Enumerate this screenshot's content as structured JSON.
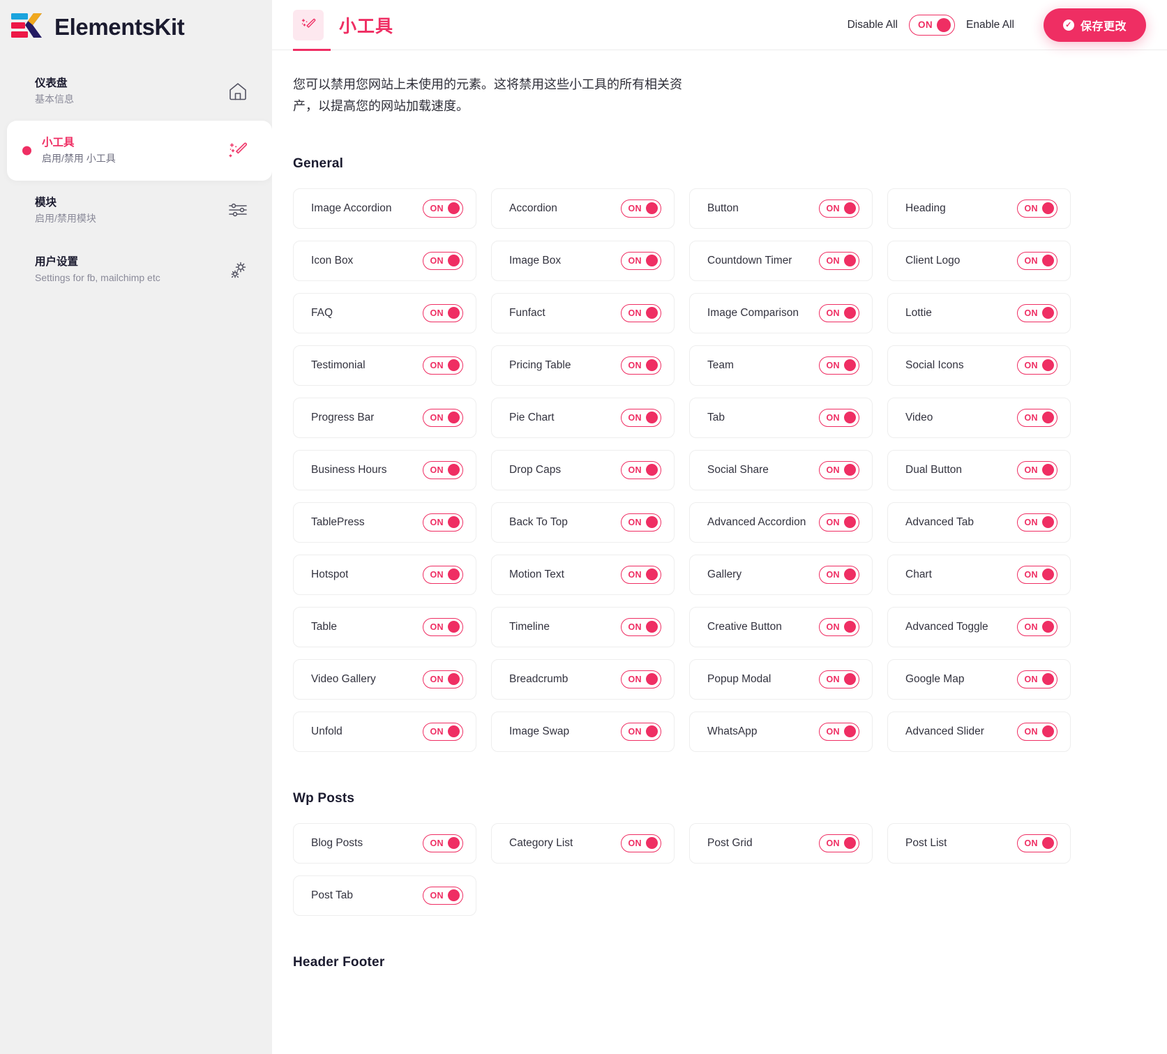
{
  "brand": {
    "name": "ElementsKit",
    "logo_icon": "elementskit-logo"
  },
  "sidebar": {
    "items": [
      {
        "title": "仪表盘",
        "subtitle": "基本信息",
        "icon": "home-icon",
        "active": false
      },
      {
        "title": "小工具",
        "subtitle": "启用/禁用 小工具",
        "icon": "magic-wand-icon",
        "active": true
      },
      {
        "title": "模块",
        "subtitle": "启用/禁用模块",
        "icon": "sliders-icon",
        "active": false
      },
      {
        "title": "用户设置",
        "subtitle": "Settings for fb, mailchimp etc",
        "icon": "gear-icon",
        "active": false
      }
    ]
  },
  "header": {
    "tab_label": "小工具",
    "tab_icon": "magic-wand-icon",
    "disable_all_label": "Disable All",
    "enable_all_label": "Enable All",
    "master_toggle": "ON",
    "save_label": "保存更改",
    "save_icon": "check-circle-icon"
  },
  "colors": {
    "accent": "#ef2e63",
    "sidebar_bg": "#f0f0f0",
    "card_border": "#eeeeee",
    "text": "#33333f"
  },
  "intro": "您可以禁用您网站上未使用的元素。这将禁用这些小工具的所有相关资产，以提高您的网站加载速度。",
  "toggle_on_label": "ON",
  "sections": [
    {
      "title": "General",
      "widgets": [
        {
          "name": "Image Accordion",
          "state": "ON"
        },
        {
          "name": "Accordion",
          "state": "ON"
        },
        {
          "name": "Button",
          "state": "ON"
        },
        {
          "name": "Heading",
          "state": "ON"
        },
        {
          "name": "Icon Box",
          "state": "ON"
        },
        {
          "name": "Image Box",
          "state": "ON"
        },
        {
          "name": "Countdown Timer",
          "state": "ON"
        },
        {
          "name": "Client Logo",
          "state": "ON"
        },
        {
          "name": "FAQ",
          "state": "ON"
        },
        {
          "name": "Funfact",
          "state": "ON"
        },
        {
          "name": "Image Comparison",
          "state": "ON"
        },
        {
          "name": "Lottie",
          "state": "ON"
        },
        {
          "name": "Testimonial",
          "state": "ON"
        },
        {
          "name": "Pricing Table",
          "state": "ON"
        },
        {
          "name": "Team",
          "state": "ON"
        },
        {
          "name": "Social Icons",
          "state": "ON"
        },
        {
          "name": "Progress Bar",
          "state": "ON"
        },
        {
          "name": "Pie Chart",
          "state": "ON"
        },
        {
          "name": "Tab",
          "state": "ON"
        },
        {
          "name": "Video",
          "state": "ON"
        },
        {
          "name": "Business Hours",
          "state": "ON"
        },
        {
          "name": "Drop Caps",
          "state": "ON"
        },
        {
          "name": "Social Share",
          "state": "ON"
        },
        {
          "name": "Dual Button",
          "state": "ON"
        },
        {
          "name": "TablePress",
          "state": "ON"
        },
        {
          "name": "Back To Top",
          "state": "ON"
        },
        {
          "name": "Advanced Accordion",
          "state": "ON"
        },
        {
          "name": "Advanced Tab",
          "state": "ON"
        },
        {
          "name": "Hotspot",
          "state": "ON"
        },
        {
          "name": "Motion Text",
          "state": "ON"
        },
        {
          "name": "Gallery",
          "state": "ON"
        },
        {
          "name": "Chart",
          "state": "ON"
        },
        {
          "name": "Table",
          "state": "ON"
        },
        {
          "name": "Timeline",
          "state": "ON"
        },
        {
          "name": "Creative Button",
          "state": "ON"
        },
        {
          "name": "Advanced Toggle",
          "state": "ON"
        },
        {
          "name": "Video Gallery",
          "state": "ON"
        },
        {
          "name": "Breadcrumb",
          "state": "ON"
        },
        {
          "name": "Popup Modal",
          "state": "ON"
        },
        {
          "name": "Google Map",
          "state": "ON"
        },
        {
          "name": "Unfold",
          "state": "ON"
        },
        {
          "name": "Image Swap",
          "state": "ON"
        },
        {
          "name": "WhatsApp",
          "state": "ON"
        },
        {
          "name": "Advanced Slider",
          "state": "ON"
        }
      ]
    },
    {
      "title": "Wp Posts",
      "widgets": [
        {
          "name": "Blog Posts",
          "state": "ON"
        },
        {
          "name": "Category List",
          "state": "ON"
        },
        {
          "name": "Post Grid",
          "state": "ON"
        },
        {
          "name": "Post List",
          "state": "ON"
        },
        {
          "name": "Post Tab",
          "state": "ON"
        }
      ]
    },
    {
      "title": "Header Footer",
      "widgets": []
    }
  ]
}
